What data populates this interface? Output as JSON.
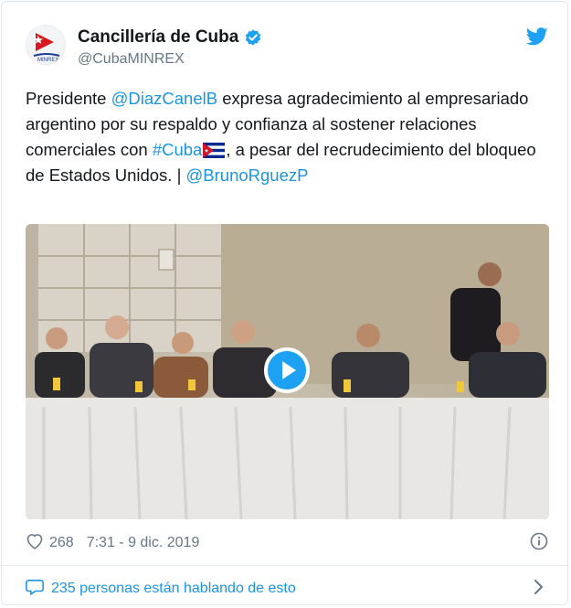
{
  "author": {
    "display_name": "Cancillería de Cuba",
    "handle": "@CubaMINREX",
    "avatar_text": "MINREX"
  },
  "tweet": {
    "segments": [
      {
        "text": "Presidente ",
        "type": "text"
      },
      {
        "text": "@DiazCanelB",
        "type": "mention"
      },
      {
        "text": " expresa agradecimiento al empresariado argentino por su respaldo y confianza al sostener relaciones comerciales con ",
        "type": "text"
      },
      {
        "text": "#Cuba",
        "type": "hashtag"
      },
      {
        "text": "cuba-flag-emoji",
        "type": "emoji"
      },
      {
        "text": ", a pesar del recrudecimiento del bloqueo de Estados Unidos. | ",
        "type": "text"
      },
      {
        "text": "@BrunoRguezP",
        "type": "mention"
      }
    ]
  },
  "media": {
    "type": "video",
    "icon": "play-icon"
  },
  "footer": {
    "like_count": "268",
    "timestamp": "7:31 - 9 dic. 2019"
  },
  "conversation": {
    "label": "235 personas están hablando de esto"
  },
  "colors": {
    "link": "#1b95e0",
    "twitter_blue": "#1da1f2",
    "secondary_text": "#657786",
    "primary_text": "#14171a"
  }
}
